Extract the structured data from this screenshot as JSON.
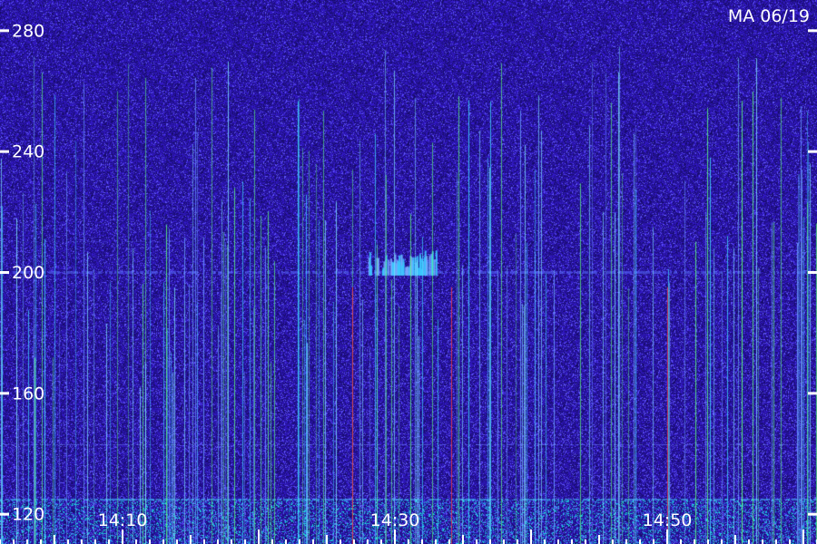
{
  "chart_data": {
    "type": "heatmap",
    "title": "",
    "stamp": "MA 06/19",
    "xlabel": "",
    "ylabel": "",
    "y_ticks": [
      280,
      240,
      200,
      160,
      120
    ],
    "ylim": [
      110,
      290
    ],
    "x_ticks": [
      "14:10",
      "14:30",
      "14:50"
    ],
    "x_tick_minutes": [
      10,
      30,
      50
    ],
    "xlim_minutes": [
      1,
      61
    ],
    "grid": false,
    "colors": {
      "background": "#1c0f6e",
      "noise_low": "#2a1aa8",
      "noise_high": "#4a3cf0",
      "trace_cyan": "#3fe0ff",
      "trace_green": "#5dff7a",
      "trace_red": "#ff3a3a",
      "text": "#ffffff"
    },
    "features": {
      "horizontal_band_y": 200,
      "echo_burst_minutes": [
        28,
        33
      ],
      "low_band_y": [
        113,
        125
      ]
    }
  }
}
